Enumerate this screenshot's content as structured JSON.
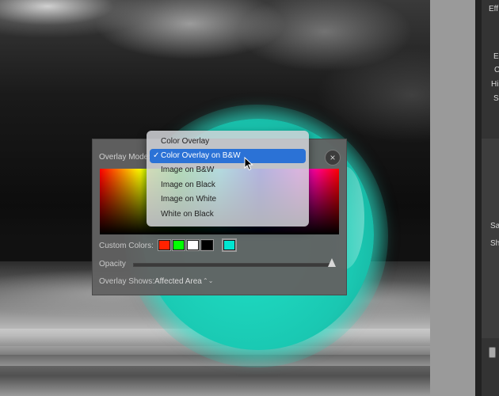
{
  "overlay_panel": {
    "mode_label": "Overlay Mode:",
    "custom_colors_label": "Custom Colors:",
    "opacity_label": "Opacity",
    "opacity_level": 0.98,
    "overlay_shows_label": "Overlay Shows:",
    "overlay_shows_value": "Affected Area",
    "swatches": [
      "#ff2200",
      "#00ff00",
      "#ffffff",
      "#000000",
      "#00e5d0"
    ]
  },
  "dropdown": {
    "selected_index": 1,
    "options": [
      {
        "label": "Color Overlay"
      },
      {
        "label": "Color Overlay on B&W"
      },
      {
        "label": "Image on B&W"
      },
      {
        "label": "Image on Black"
      },
      {
        "label": "Image on White"
      },
      {
        "label": "White on Black"
      }
    ]
  },
  "right_panel": {
    "labels": [
      "Eff",
      "E",
      "C",
      "Hi",
      "S",
      "Sa",
      "Sh"
    ]
  },
  "colors": {
    "accent": "#2b72d6",
    "overlay_teal": "#1fe0c6"
  }
}
